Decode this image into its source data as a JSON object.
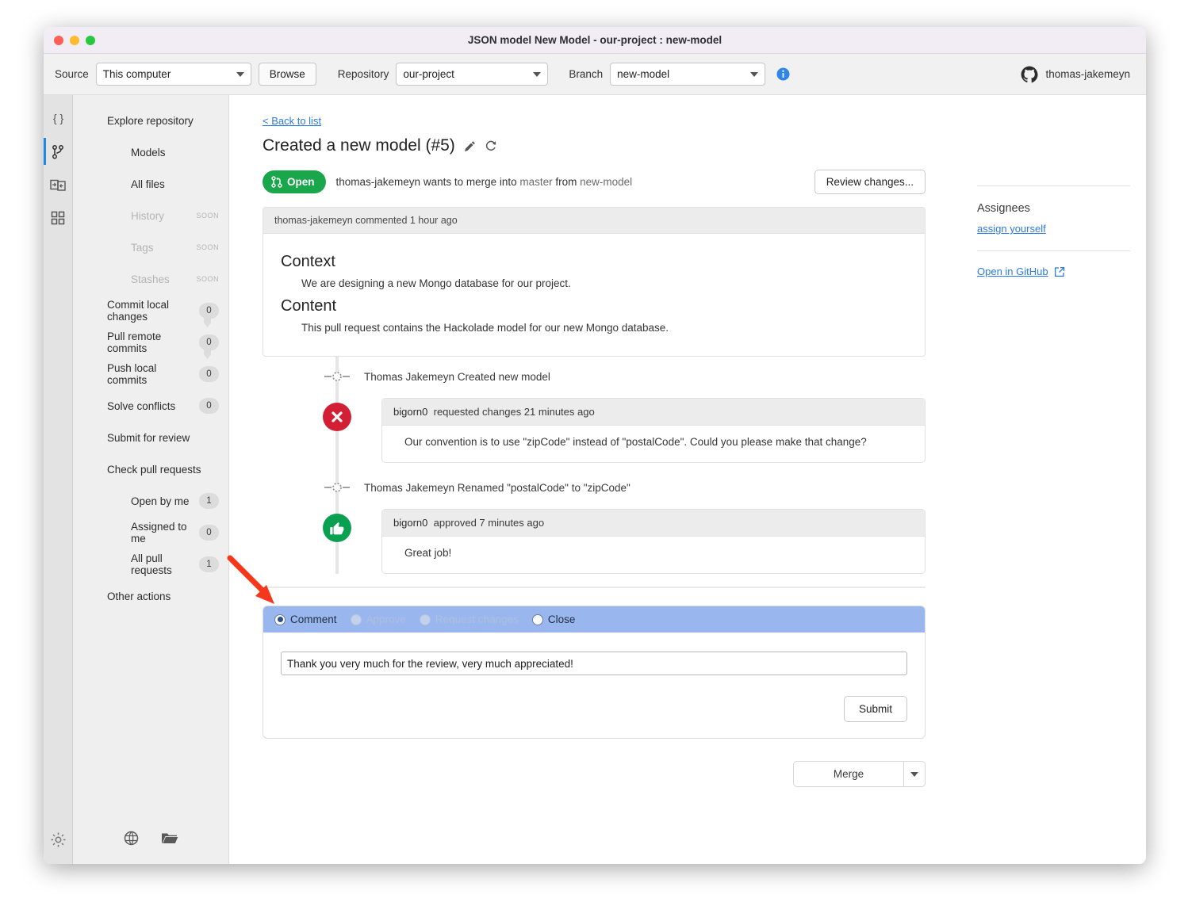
{
  "window": {
    "title": "JSON model New Model - our-project : new-model",
    "traffic_lights": [
      "close",
      "minimize",
      "maximize"
    ]
  },
  "toolbar": {
    "source_label": "Source",
    "source_value": "This computer",
    "browse_label": "Browse",
    "repository_label": "Repository",
    "repository_value": "our-project",
    "branch_label": "Branch",
    "branch_value": "new-model",
    "info_icon": "info-icon",
    "user_name": "thomas-jakemeyn",
    "user_icon": "github-icon"
  },
  "rail": {
    "items": [
      {
        "name": "json-braces-icon",
        "active": false
      },
      {
        "name": "git-branch-icon",
        "active": true
      },
      {
        "name": "compare-models-icon",
        "active": false
      },
      {
        "name": "grid-apps-icon",
        "active": false
      }
    ],
    "settings_icon": "gear-icon"
  },
  "sidebar": {
    "items": [
      {
        "label": "Explore repository",
        "level": "top"
      },
      {
        "label": "Models",
        "level": "sub"
      },
      {
        "label": "All files",
        "level": "sub"
      },
      {
        "label": "History",
        "level": "sub",
        "disabled": true,
        "tag": "SOON"
      },
      {
        "label": "Tags",
        "level": "sub",
        "disabled": true,
        "tag": "SOON"
      },
      {
        "label": "Stashes",
        "level": "sub",
        "disabled": true,
        "tag": "SOON"
      },
      {
        "label": "Commit local changes",
        "level": "top",
        "badge": "0",
        "connector": true
      },
      {
        "label": "Pull remote commits",
        "level": "top",
        "badge": "0",
        "connector": true
      },
      {
        "label": "Push local commits",
        "level": "top",
        "badge": "0"
      },
      {
        "label": "Solve conflicts",
        "level": "top",
        "badge": "0"
      },
      {
        "label": "Submit for review",
        "level": "top"
      },
      {
        "label": "Check pull requests",
        "level": "top"
      },
      {
        "label": "Open by me",
        "level": "sub",
        "badge": "1"
      },
      {
        "label": "Assigned to me",
        "level": "sub",
        "badge": "0"
      },
      {
        "label": "All pull requests",
        "level": "sub",
        "badge": "1"
      },
      {
        "label": "Other actions",
        "level": "top"
      }
    ],
    "bottom_icons": [
      {
        "name": "globe-icon"
      },
      {
        "name": "folder-open-icon"
      }
    ]
  },
  "main": {
    "back_link": "< Back to list",
    "pr_title": "Created a new model (#5)",
    "title_icons": [
      "pencil-icon",
      "refresh-icon"
    ],
    "status_badge": "Open",
    "merge_desc_author": "thomas-jakemeyn",
    "merge_desc_mid": " wants to merge into ",
    "merge_desc_target": "master",
    "merge_desc_from": " from ",
    "merge_desc_source": "new-model",
    "review_changes_label": "Review changes...",
    "description": {
      "header": "thomas-jakemeyn commented 1 hour ago",
      "sections": [
        {
          "heading": "Context",
          "text": "We are designing a new Mongo database for our project."
        },
        {
          "heading": "Content",
          "text": "This pull request contains the Hackolade model for our new Mongo database."
        }
      ]
    },
    "timeline": [
      {
        "kind": "event",
        "text": "Thomas Jakemeyn Created new model",
        "icon": "commit-node-icon"
      },
      {
        "kind": "review",
        "icon": "rejected-icon",
        "icon_color": "#d31f33",
        "header_user": "bigorn0",
        "header_action": "requested changes 21 minutes ago",
        "body": "Our convention is to use \"zipCode\" instead of \"postalCode\". Could you please make that change?"
      },
      {
        "kind": "event",
        "text": "Thomas Jakemeyn Renamed \"postalCode\" to \"zipCode\"",
        "icon": "commit-node-icon"
      },
      {
        "kind": "review",
        "icon": "thumbs-up-icon",
        "icon_color": "#0aa051",
        "header_user": "bigorn0",
        "header_action": "approved 7 minutes ago",
        "body": "Great job!"
      }
    ],
    "comment_form": {
      "options": [
        {
          "label": "Comment",
          "selected": true,
          "disabled": false
        },
        {
          "label": "Approve",
          "selected": false,
          "disabled": true
        },
        {
          "label": "Request changes",
          "selected": false,
          "disabled": true
        },
        {
          "label": "Close",
          "selected": false,
          "disabled": false
        }
      ],
      "input_value": "Thank you very much for the review, very much appreciated!",
      "input_placeholder": "",
      "submit_label": "Submit"
    },
    "merge_label": "Merge"
  },
  "right_panel": {
    "assignees_title": "Assignees",
    "assign_link": "assign yourself",
    "open_in_github": "Open in GitHub",
    "external_icon": "external-link-icon"
  },
  "colors": {
    "accent_link": "#2a7ae2",
    "open_green": "#1aa64b",
    "reject_red": "#d31f33",
    "approve_green": "#0aa051",
    "form_header_blue": "#9ab6ee",
    "annotation_red": "#f5381c"
  }
}
